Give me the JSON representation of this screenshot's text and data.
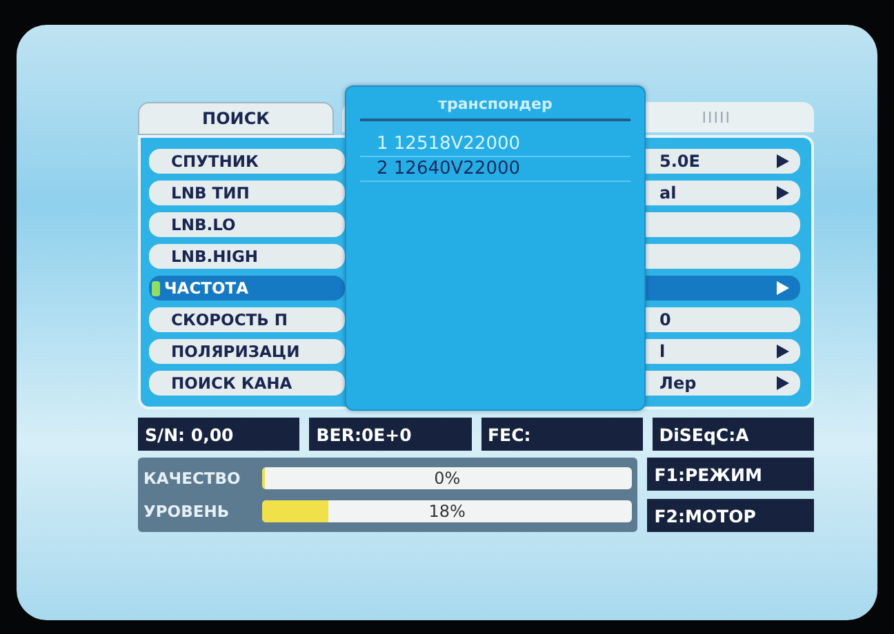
{
  "header": {
    "title": "ПОИСК",
    "indicator": "IIIII"
  },
  "rows": [
    {
      "label": "СПУТНИК",
      "value": "5.0E",
      "arrow": true,
      "selected": false
    },
    {
      "label": "LNB ТИП",
      "value": "al",
      "arrow": true,
      "selected": false
    },
    {
      "label": "LNB.LO",
      "arrow": false,
      "selected": false
    },
    {
      "label": "LNB.HIGH",
      "arrow": false,
      "selected": false
    },
    {
      "label": "ЧАСТОТА",
      "arrow": true,
      "selected": true
    },
    {
      "label": "СКОРОСТЬ П",
      "value": "0",
      "arrow": false,
      "selected": false
    },
    {
      "label": "ПОЛЯРИЗАЦИ",
      "value": "l",
      "arrow": true,
      "selected": false
    },
    {
      "label": "ПОИСК КАНА",
      "value": "Лер",
      "arrow": true,
      "selected": false
    }
  ],
  "popup": {
    "title": "транспондер",
    "items": [
      {
        "label": "1 12518V22000",
        "selected": true
      },
      {
        "label": "2 12640V22000",
        "selected": false
      }
    ]
  },
  "status": [
    "S/N: 0,00",
    "BER:0E+0",
    "FEC:",
    "DiSEqC:A"
  ],
  "meters": [
    {
      "label": "КАЧЕСТВО",
      "level": 0,
      "reading": "0%"
    },
    {
      "label": "УРОВЕНЬ",
      "level": 0.18,
      "reading": "18%"
    }
  ],
  "function_keys": [
    "F1:РЕЖИМ",
    "F2:МОТОР"
  ]
}
